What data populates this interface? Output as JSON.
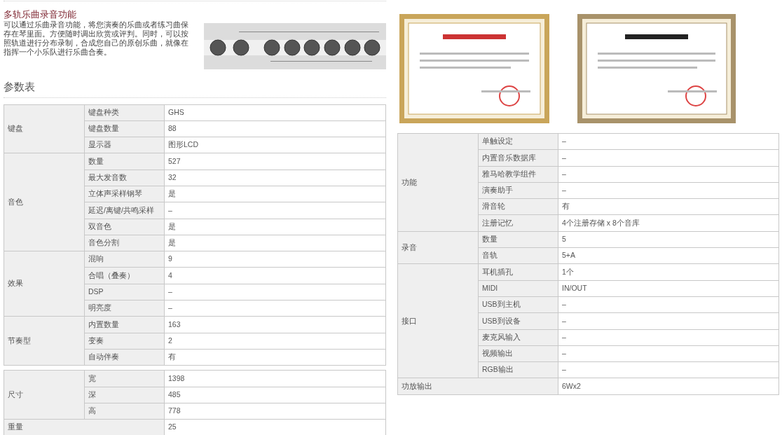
{
  "intro": {
    "title": "多轨乐曲录音功能",
    "text": "可以通过乐曲录音功能，将您演奏的乐曲或者练习曲保存在琴里面。方便随时调出欣赏或评判。同时，可以按照轨道进行分布录制，合成您自己的原创乐曲，就像在指挥一个小乐队进行乐曲合奏。"
  },
  "spec_heading": "参数表",
  "left_tables": [
    {
      "groups": [
        {
          "kind": "group",
          "label": "键盘",
          "rows": [
            {
              "label": "键盘种类",
              "value": "GHS"
            },
            {
              "label": "键盘数量",
              "value": "88"
            },
            {
              "label": "显示器",
              "value": "图形LCD"
            }
          ]
        },
        {
          "kind": "group",
          "label": "音色",
          "rows": [
            {
              "label": "数量",
              "value": "527"
            },
            {
              "label": "最大发音数",
              "value": "32"
            },
            {
              "label": "立体声采样钢琴",
              "value": "是"
            },
            {
              "label": "延迟/离键/共鸣采样",
              "value": "–"
            },
            {
              "label": "双音色",
              "value": "是"
            },
            {
              "label": "音色分割",
              "value": "是"
            }
          ]
        },
        {
          "kind": "group",
          "label": "效果",
          "rows": [
            {
              "label": "混响",
              "value": "9"
            },
            {
              "label": "合唱（叠奏）",
              "value": "4"
            },
            {
              "label": "DSP",
              "value": "–"
            },
            {
              "label": "明亮度",
              "value": "–"
            }
          ]
        },
        {
          "kind": "group",
          "label": "节奏型",
          "rows": [
            {
              "label": "内置数量",
              "value": "163"
            },
            {
              "label": "变奏",
              "value": "2"
            },
            {
              "label": "自动伴奏",
              "value": "有"
            }
          ]
        }
      ]
    },
    {
      "groups": [
        {
          "kind": "group",
          "label": "尺寸",
          "rows": [
            {
              "label": "宽",
              "value": "1398"
            },
            {
              "label": "深",
              "value": "485"
            },
            {
              "label": "高",
              "value": "778"
            }
          ]
        },
        {
          "kind": "single",
          "label": "重量",
          "value": "25"
        }
      ]
    }
  ],
  "right_tables": [
    {
      "groups": [
        {
          "kind": "group",
          "label": "功能",
          "rows": [
            {
              "label": "单触设定",
              "value": "–"
            },
            {
              "label": "内置音乐数据库",
              "value": "–"
            },
            {
              "label": "雅马哈教学组件",
              "value": "–"
            },
            {
              "label": "演奏助手",
              "value": "–"
            },
            {
              "label": "滑音轮",
              "value": "有"
            },
            {
              "label": "注册记忆",
              "value": "4个注册存储 x 8个音库"
            }
          ]
        },
        {
          "kind": "group",
          "label": "录音",
          "rows": [
            {
              "label": "数量",
              "value": "5"
            },
            {
              "label": "音轨",
              "value": "5+A"
            }
          ]
        },
        {
          "kind": "group",
          "label": "接口",
          "rows": [
            {
              "label": "耳机插孔",
              "value": "1个"
            },
            {
              "label": "MIDI",
              "value": "IN/OUT"
            },
            {
              "label": "USB到主机",
              "value": "–"
            },
            {
              "label": "USB到设备",
              "value": "–"
            },
            {
              "label": "麦克风输入",
              "value": "–"
            },
            {
              "label": "视频输出",
              "value": "–"
            },
            {
              "label": "RGB输出",
              "value": "–"
            }
          ]
        },
        {
          "kind": "single",
          "label": "功放输出",
          "value": "6Wx2"
        }
      ]
    }
  ]
}
